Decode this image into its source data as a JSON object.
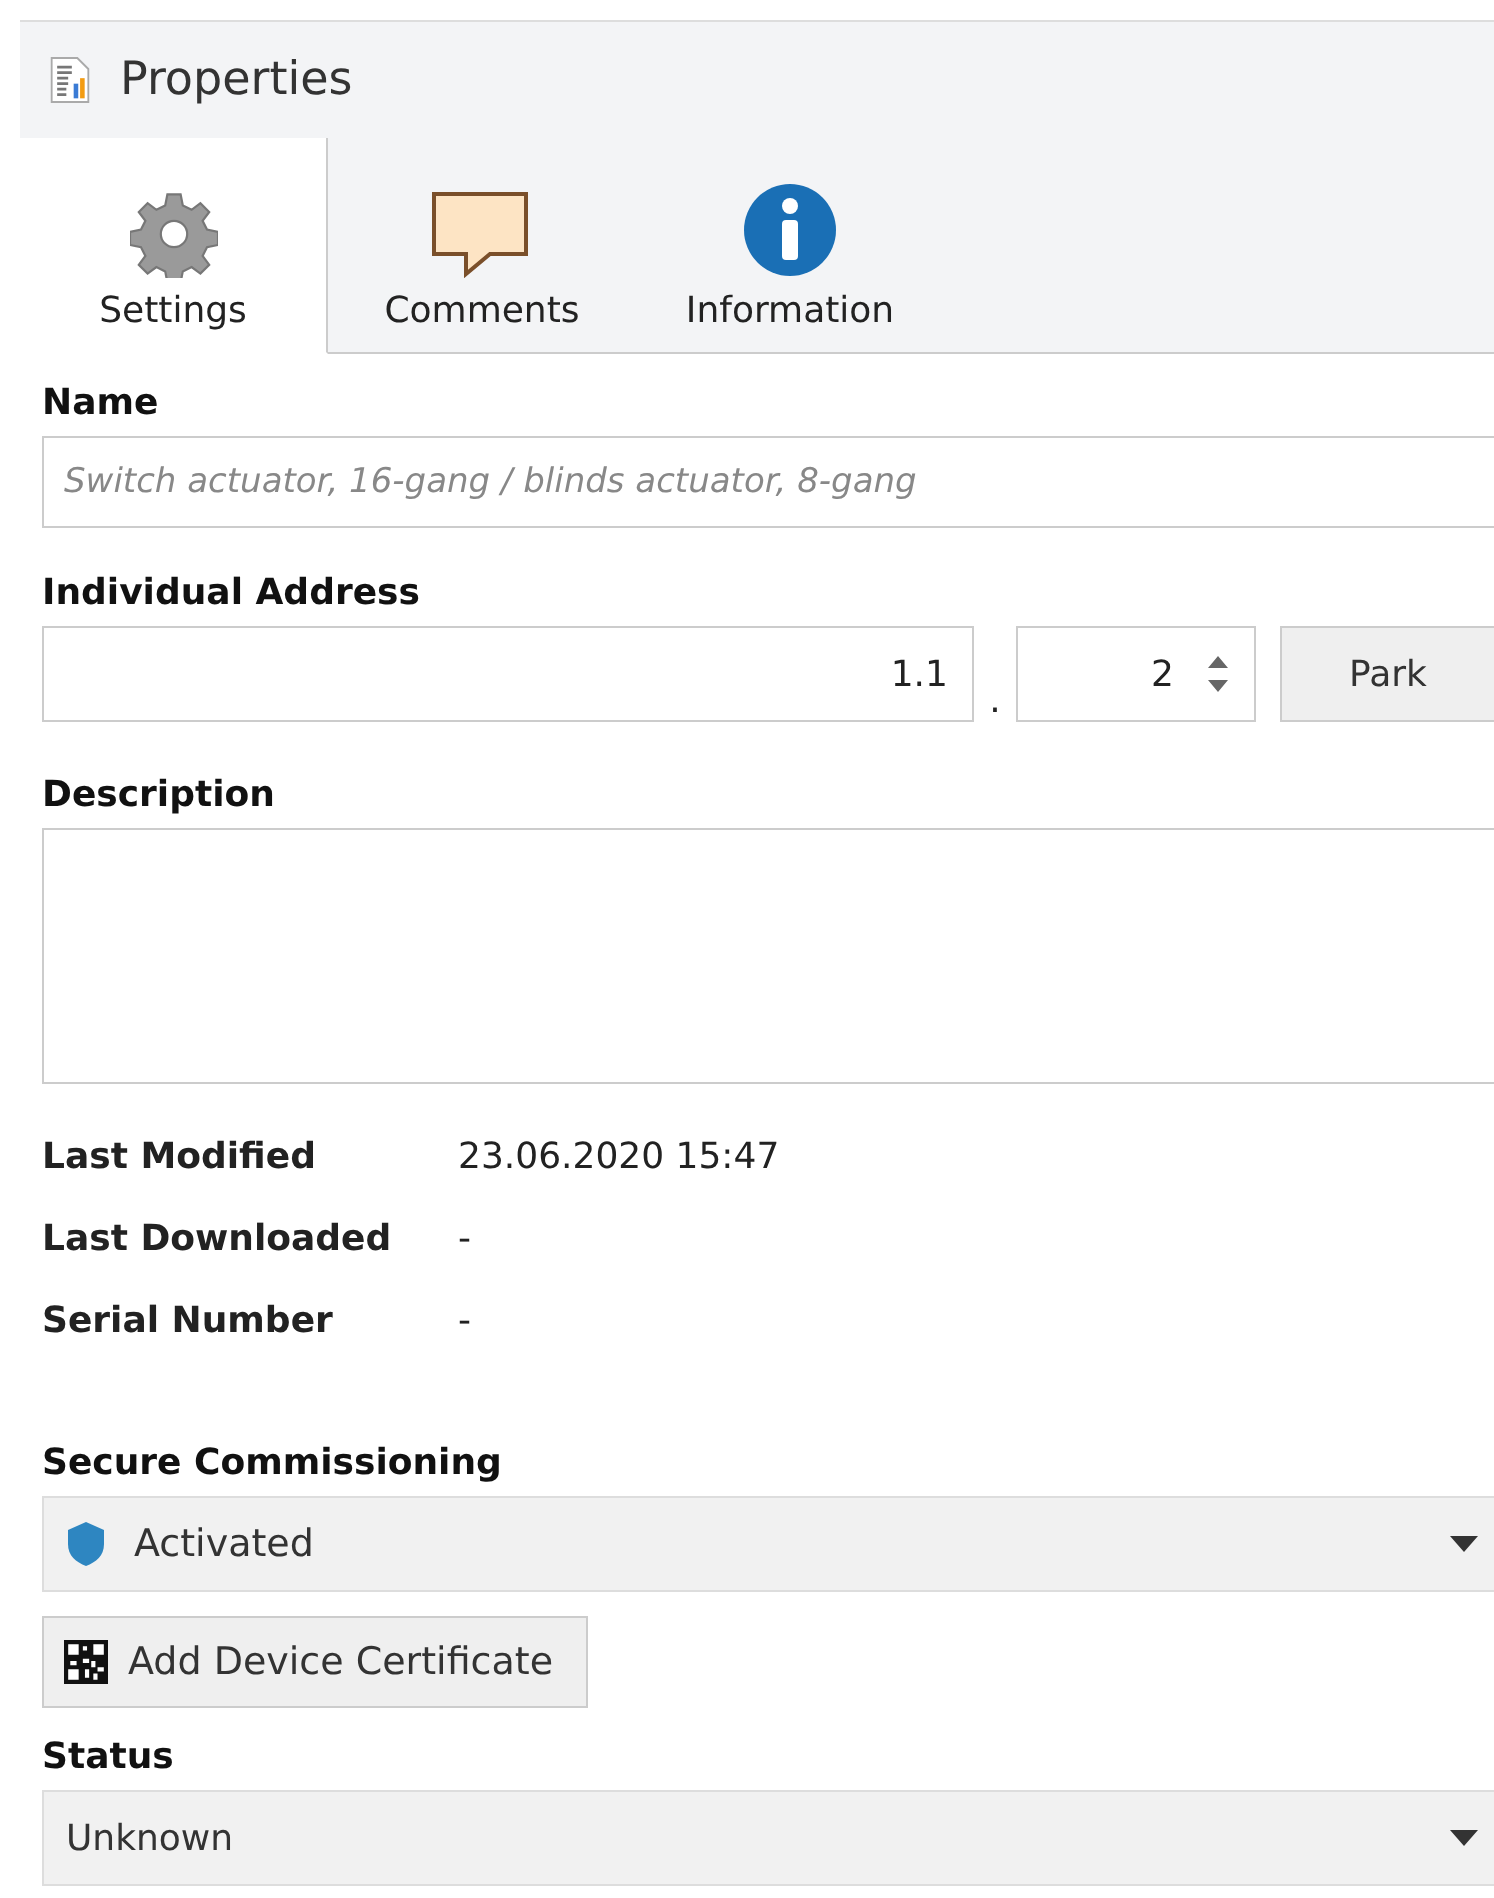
{
  "panel": {
    "title": "Properties"
  },
  "tabs": [
    {
      "label": "Settings",
      "kind": "gear",
      "selected": true
    },
    {
      "label": "Comments",
      "kind": "comment",
      "selected": false
    },
    {
      "label": "Information",
      "kind": "info",
      "selected": false
    }
  ],
  "name": {
    "label": "Name",
    "placeholder": "Switch actuator, 16-gang / blinds actuator, 8-gang"
  },
  "address": {
    "label": "Individual Address",
    "line": "1.1",
    "separator": ".",
    "device": "2",
    "park_button": "Park"
  },
  "description": {
    "label": "Description"
  },
  "info_rows": [
    {
      "label": "Last Modified",
      "value": "23.06.2020 15:47"
    },
    {
      "label": "Last Downloaded",
      "value": "-"
    },
    {
      "label": "Serial Number",
      "value": "-"
    }
  ],
  "secure_commissioning": {
    "label": "Secure Commissioning",
    "value": "Activated",
    "certificate_button": "Add Device Certificate"
  },
  "status": {
    "label": "Status",
    "value": "Unknown"
  }
}
